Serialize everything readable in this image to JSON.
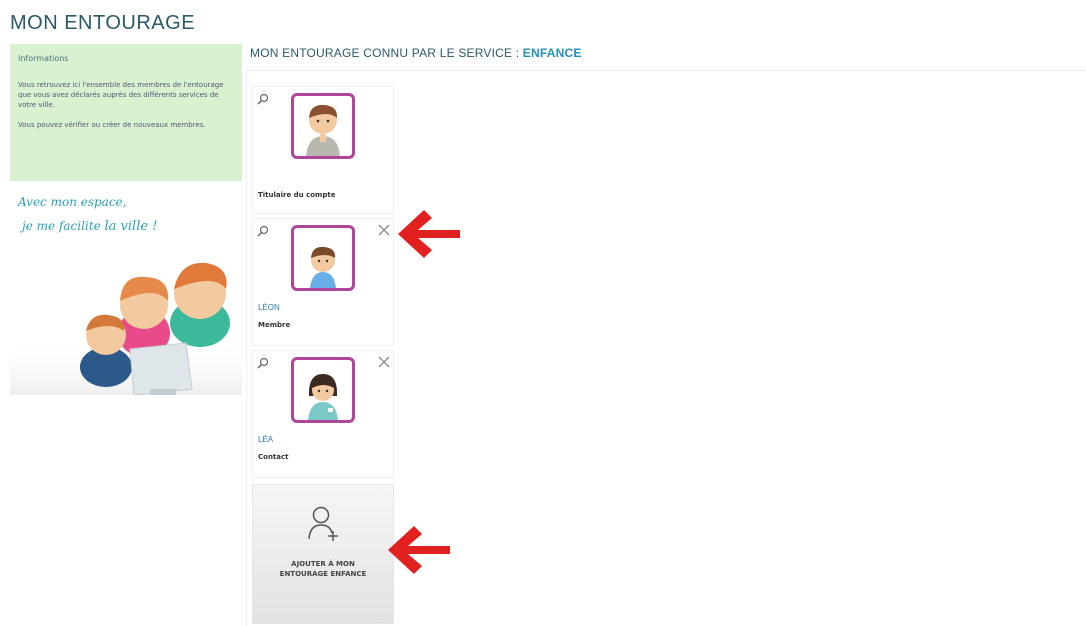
{
  "page": {
    "title": "MON ENTOURAGE"
  },
  "sidebar": {
    "info_title": "Informations",
    "info_p1": "Vous retrouvez ici l'ensemble des membres de l'entourage que vous avez déclarés auprès des différents services de votre ville.",
    "info_p2": "Vous pouvez vérifier ou créer de nouveaux membres.",
    "promo_line1": "Avec mon espace,",
    "promo_line2a": "je me facilite",
    "promo_line2b": "la ville !"
  },
  "section": {
    "heading_prefix": "MON ENTOURAGE CONNU PAR LE SERVICE :",
    "service": "ENFANCE"
  },
  "members": [
    {
      "name": "",
      "role": "Titulaire du compte",
      "removable": false,
      "avatar": "adult-man"
    },
    {
      "name": "LÉON",
      "role": "Membre",
      "removable": true,
      "avatar": "boy"
    },
    {
      "name": "LÉA",
      "role": "Contact",
      "removable": true,
      "avatar": "woman"
    }
  ],
  "add_button": {
    "line1": "AJOUTER À MON",
    "line2": "ENTOURAGE ENFANCE"
  },
  "colors": {
    "avatar_border": "#b0459a",
    "info_bg": "#d8f2d0",
    "accent": "#2090b8",
    "arrow": "#e0211f"
  },
  "icons": {
    "zoom": "magnifier-icon",
    "close": "close-icon",
    "add_user": "add-user-icon",
    "arrow": "red-arrow-left"
  }
}
